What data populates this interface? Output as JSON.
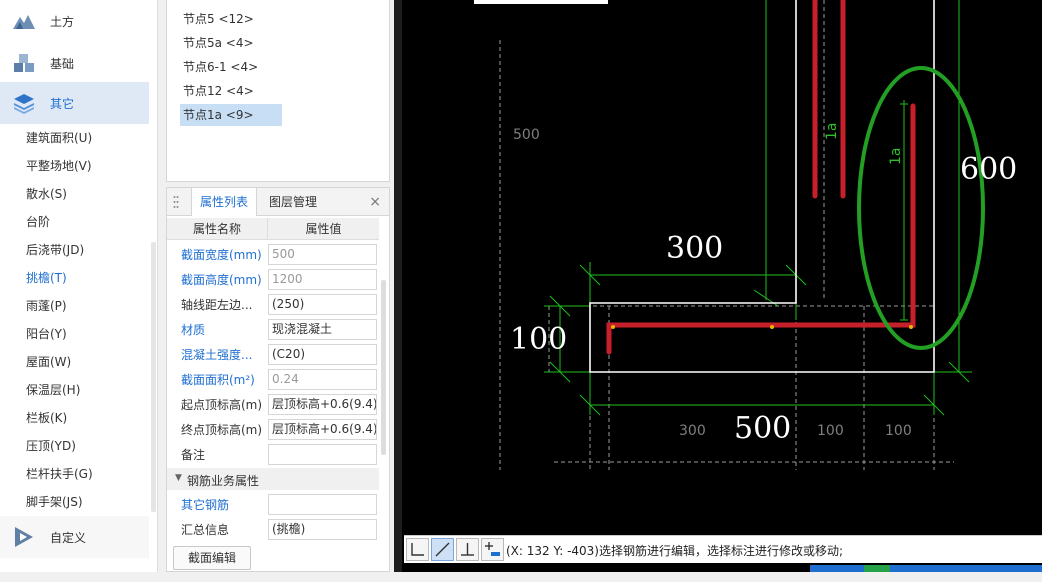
{
  "nav": {
    "categories": [
      {
        "label": "土方",
        "icon": "earthwork-icon"
      },
      {
        "label": "基础",
        "icon": "foundation-icon"
      },
      {
        "label": "其它",
        "icon": "layers-icon"
      },
      {
        "label": "自定义",
        "icon": "custom-icon"
      }
    ],
    "items": [
      "建筑面积(U)",
      "平整场地(V)",
      "散水(S)",
      "台阶",
      "后浇带(JD)",
      "挑檐(T)",
      "雨蓬(P)",
      "阳台(Y)",
      "屋面(W)",
      "保温层(H)",
      "栏板(K)",
      "压顶(YD)",
      "栏杆扶手(G)",
      "脚手架(JS)"
    ],
    "selected_item": "挑檐(T)"
  },
  "nodes": [
    "节点5 <12>",
    "节点5a <4>",
    "节点6-1 <4>",
    "节点12 <4>",
    "节点1a <9>"
  ],
  "props": {
    "tabs": [
      "属性列表",
      "图层管理"
    ],
    "close": "×",
    "header": {
      "name": "属性名称",
      "value": "属性值"
    },
    "rows": [
      {
        "name": "截面宽度(mm)",
        "value": "500",
        "blue": true,
        "gray": true
      },
      {
        "name": "截面高度(mm)",
        "value": "1200",
        "blue": true,
        "gray": true
      },
      {
        "name": "轴线距左边...",
        "value": "(250)",
        "blue": false,
        "gray": false
      },
      {
        "name": "材质",
        "value": "现浇混凝土",
        "blue": true,
        "gray": false
      },
      {
        "name": "混凝土强度...",
        "value": "(C20)",
        "blue": true,
        "gray": false
      },
      {
        "name": "截面面积(m²)",
        "value": "0.24",
        "blue": true,
        "gray": true
      },
      {
        "name": "起点顶标高(m)",
        "value": "层顶标高+0.6(9.4)",
        "blue": false,
        "gray": false
      },
      {
        "name": "终点顶标高(m)",
        "value": "层顶标高+0.6(9.4)",
        "blue": false,
        "gray": false
      },
      {
        "name": "备注",
        "value": "",
        "blue": false,
        "gray": false
      }
    ],
    "section": "钢筋业务属性",
    "rows2": [
      {
        "name": "其它钢筋",
        "value": "",
        "blue": true
      },
      {
        "name": "汇总信息",
        "value": "(挑檐)",
        "blue": false
      }
    ],
    "button": "截面编辑"
  },
  "cad": {
    "dims": {
      "d300_top": "300",
      "d100_left": "100",
      "d500_bottom": "500",
      "d600_right": "600",
      "d500_small": "500",
      "d300_small": "300",
      "d100_small_a": "100",
      "d100_small_b": "100",
      "la1": "1a",
      "la2": "1a"
    },
    "rebar_color": "#c8202a",
    "annotation_color": "#2e9b2e"
  },
  "status": {
    "text": "(X: 132 Y: -403)选择钢筋进行编辑，选择标注进行修改或移动;"
  }
}
